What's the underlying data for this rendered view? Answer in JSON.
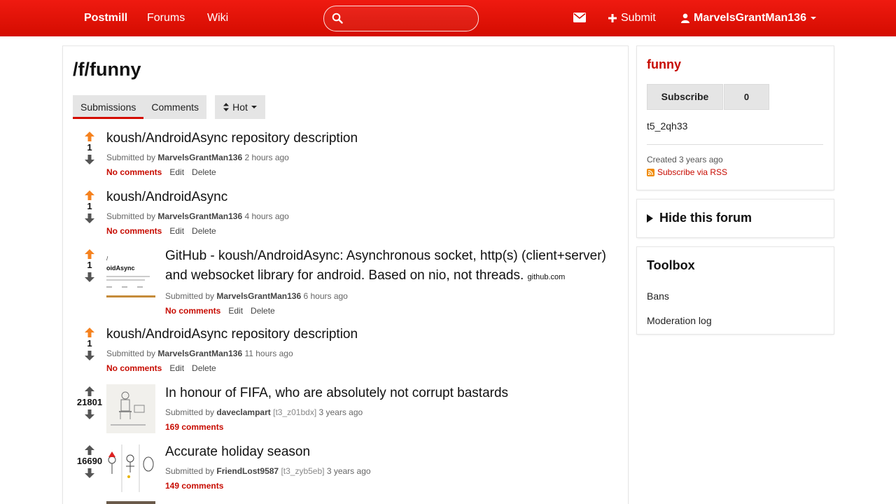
{
  "nav": {
    "brand": "Postmill",
    "forums": "Forums",
    "wiki": "Wiki",
    "search_placeholder": "",
    "submit_label": "Submit",
    "username": "MarvelsGrantMan136"
  },
  "page": {
    "title": "/f/funny",
    "tabs": [
      {
        "label": "Submissions",
        "active": true
      },
      {
        "label": "Comments",
        "active": false
      }
    ],
    "sort_label": "Hot"
  },
  "submissions": [
    {
      "votes": "1",
      "title": "koush/AndroidAsync repository description",
      "domain": "",
      "author": "MarvelsGrantMan136",
      "flair": "",
      "time": "2 hours ago",
      "comments": "No comments",
      "edit": "Edit",
      "delete": "Delete",
      "upvoted": true
    },
    {
      "votes": "1",
      "title": "koush/AndroidAsync",
      "domain": "",
      "author": "MarvelsGrantMan136",
      "flair": "",
      "time": "4 hours ago",
      "comments": "No comments",
      "edit": "Edit",
      "delete": "Delete",
      "upvoted": true
    },
    {
      "votes": "1",
      "title": "GitHub - koush/AndroidAsync: Asynchronous socket, http(s) (client+server) and websocket library for android. Based on nio, not threads.",
      "domain": "github.com",
      "author": "MarvelsGrantMan136",
      "flair": "",
      "time": "6 hours ago",
      "comments": "No comments",
      "edit": "Edit",
      "delete": "Delete",
      "upvoted": true,
      "thumb_text": "/ oidAsync"
    },
    {
      "votes": "1",
      "title": "koush/AndroidAsync repository description",
      "domain": "",
      "author": "MarvelsGrantMan136",
      "flair": "",
      "time": "11 hours ago",
      "comments": "No comments",
      "edit": "Edit",
      "delete": "Delete",
      "upvoted": true
    },
    {
      "votes": "21801",
      "title": "In honour of FIFA, who are absolutely not corrupt bastards",
      "domain": "",
      "author": "daveclampart",
      "flair": "[t3_z01bdx]",
      "time": "3 years ago",
      "comments": "169 comments",
      "upvoted": false
    },
    {
      "votes": "16690",
      "title": "Accurate holiday season",
      "domain": "",
      "author": "FriendLost9587",
      "flair": "[t3_zyb5eb]",
      "time": "3 years ago",
      "comments": "149 comments",
      "upvoted": false
    }
  ],
  "meta_labels": {
    "submitted_by": "Submitted by"
  },
  "sidebar": {
    "forum_name": "funny",
    "subscribe_label": "Subscribe",
    "subscriber_count": "0",
    "forum_id": "t5_2qh33",
    "created": "Created 3 years ago",
    "rss": "Subscribe via RSS",
    "hide_label": "Hide this forum",
    "toolbox_title": "Toolbox",
    "toolbox_links": [
      "Bans",
      "Moderation log"
    ]
  },
  "colors": {
    "brand_red": "#d40c00",
    "upvote_orange": "#f5821f",
    "link_red": "#c70b00"
  }
}
